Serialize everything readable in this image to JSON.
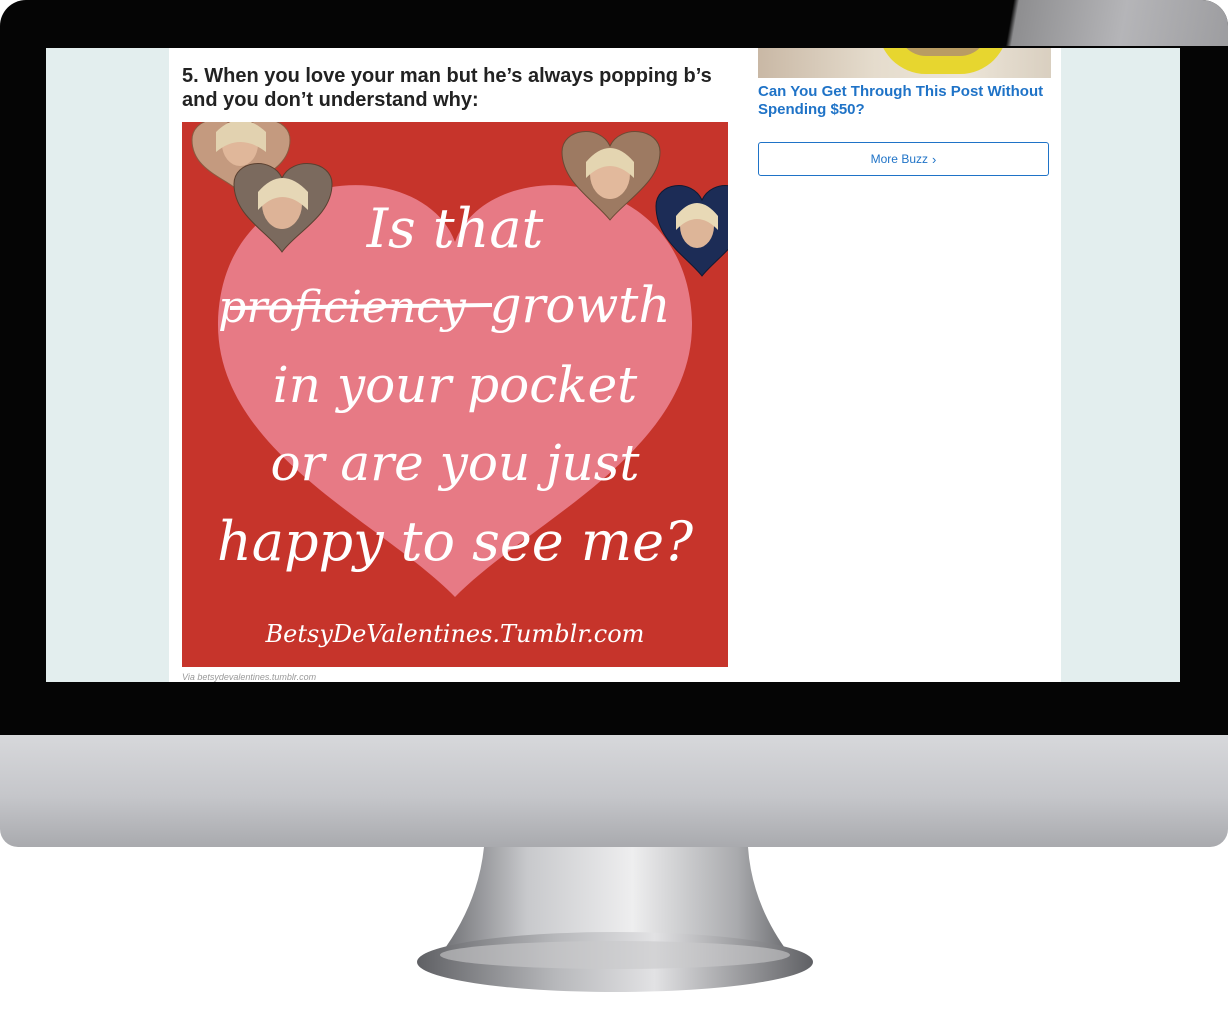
{
  "article": {
    "headline": "5. When you love your man but he’s always popping b’s and you don’t understand why:",
    "image": {
      "lines": [
        "Is that",
        "growth",
        "in your pocket",
        "or are you just",
        "happy to see me?"
      ],
      "struck_word": "proficiency",
      "watermark": "BetsyDeValentines.Tumblr.com"
    },
    "caption": "Via betsydevalentines.tumblr.com"
  },
  "sidebar": {
    "promo_title": "Can You Get Through This Post Without Spending $50?",
    "more_buzz_label": "More Buzz",
    "more_buzz_icon": "chevron-right-icon"
  },
  "colors": {
    "card_background": "#c6342b",
    "heart": "#e77a85",
    "link": "#1f73c7",
    "screen_background": "#e3eeee"
  }
}
